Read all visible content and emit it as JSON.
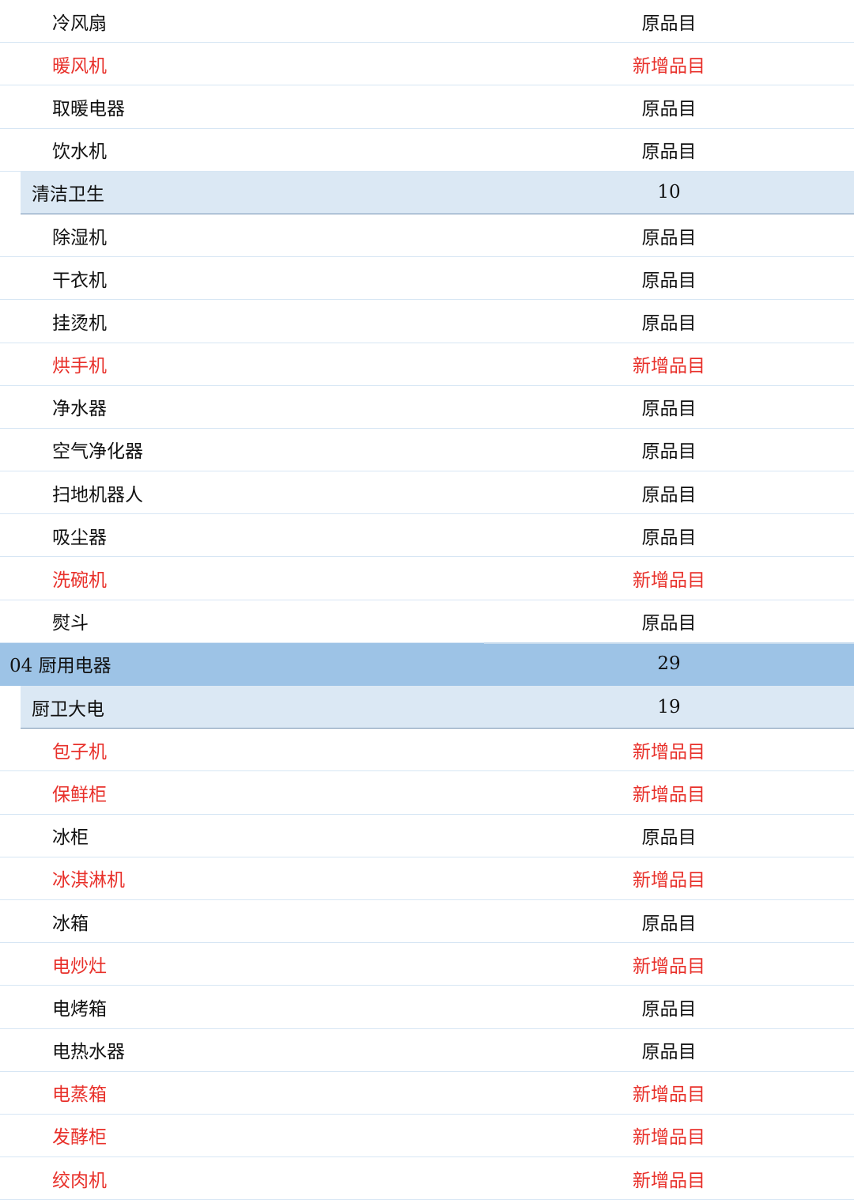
{
  "rows": [
    {
      "kind": "item",
      "name": "冷风扇",
      "status": "原品目",
      "new": false
    },
    {
      "kind": "item",
      "name": "暖风机",
      "status": "新增品目",
      "new": true
    },
    {
      "kind": "item",
      "name": "取暖电器",
      "status": "原品目",
      "new": false
    },
    {
      "kind": "item",
      "name": "饮水机",
      "status": "原品目",
      "new": false
    },
    {
      "kind": "sub",
      "name": "清洁卫生",
      "status": "10"
    },
    {
      "kind": "item",
      "name": "除湿机",
      "status": "原品目",
      "new": false
    },
    {
      "kind": "item",
      "name": "干衣机",
      "status": "原品目",
      "new": false
    },
    {
      "kind": "item",
      "name": "挂烫机",
      "status": "原品目",
      "new": false
    },
    {
      "kind": "item",
      "name": "烘手机",
      "status": "新增品目",
      "new": true
    },
    {
      "kind": "item",
      "name": "净水器",
      "status": "原品目",
      "new": false
    },
    {
      "kind": "item",
      "name": "空气净化器",
      "status": "原品目",
      "new": false
    },
    {
      "kind": "item",
      "name": "扫地机器人",
      "status": "原品目",
      "new": false
    },
    {
      "kind": "item",
      "name": "吸尘器",
      "status": "原品目",
      "new": false
    },
    {
      "kind": "item",
      "name": "洗碗机",
      "status": "新增品目",
      "new": true
    },
    {
      "kind": "item",
      "name": "熨斗",
      "status": "原品目",
      "new": false
    },
    {
      "kind": "main",
      "name": "04 厨用电器",
      "status": "29"
    },
    {
      "kind": "sub",
      "name": "厨卫大电",
      "status": "19"
    },
    {
      "kind": "item",
      "name": "包子机",
      "status": "新增品目",
      "new": true
    },
    {
      "kind": "item",
      "name": "保鲜柜",
      "status": "新增品目",
      "new": true
    },
    {
      "kind": "item",
      "name": "冰柜",
      "status": "原品目",
      "new": false
    },
    {
      "kind": "item",
      "name": "冰淇淋机",
      "status": "新增品目",
      "new": true
    },
    {
      "kind": "item",
      "name": "冰箱",
      "status": "原品目",
      "new": false
    },
    {
      "kind": "item",
      "name": "电炒灶",
      "status": "新增品目",
      "new": true
    },
    {
      "kind": "item",
      "name": "电烤箱",
      "status": "原品目",
      "new": false
    },
    {
      "kind": "item",
      "name": "电热水器",
      "status": "原品目",
      "new": false
    },
    {
      "kind": "item",
      "name": "电蒸箱",
      "status": "新增品目",
      "new": true
    },
    {
      "kind": "item",
      "name": "发酵柜",
      "status": "新增品目",
      "new": true
    },
    {
      "kind": "item",
      "name": "绞肉机",
      "status": "新增品目",
      "new": true
    }
  ]
}
